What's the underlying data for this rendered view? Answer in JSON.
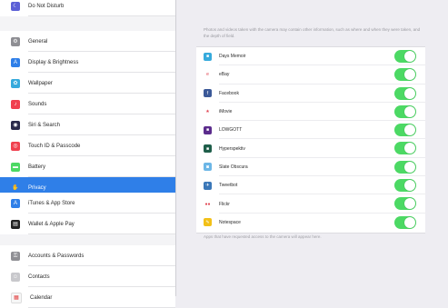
{
  "sidebar": {
    "top_item": {
      "label": "Do Not Disturb",
      "icon": "moon-icon",
      "color": "#5b5fd6"
    },
    "group1": [
      {
        "label": "General",
        "icon": "gear-icon",
        "color": "#8e8e93",
        "name": "general"
      },
      {
        "label": "Display & Brightness",
        "icon": "display-icon",
        "color": "#2f7fe8",
        "name": "display-brightness"
      },
      {
        "label": "Wallpaper",
        "icon": "wallpaper-icon",
        "color": "#36aadc",
        "name": "wallpaper"
      },
      {
        "label": "Sounds",
        "icon": "speaker-icon",
        "color": "#f0404e",
        "name": "sounds"
      },
      {
        "label": "Siri & Search",
        "icon": "siri-icon",
        "color": "#2a2a4a",
        "name": "siri-search"
      },
      {
        "label": "Touch ID & Passcode",
        "icon": "fingerprint-icon",
        "color": "#f0404e",
        "name": "touch-id-passcode"
      },
      {
        "label": "Battery",
        "icon": "battery-icon",
        "color": "#4cd964",
        "name": "battery"
      },
      {
        "label": "Privacy",
        "icon": "hand-icon",
        "color": "#2f7fe8",
        "name": "privacy",
        "selected": true
      }
    ],
    "group2": [
      {
        "label": "iTunes & App Store",
        "icon": "app-store-icon",
        "color": "#2f7fe8",
        "name": "itunes-app-store"
      },
      {
        "label": "Wallet & Apple Pay",
        "icon": "wallet-icon",
        "color": "#222222",
        "name": "wallet-apple-pay"
      }
    ],
    "group3": [
      {
        "label": "Accounts & Passwords",
        "icon": "key-icon",
        "color": "#8e8e93",
        "name": "accounts-passwords"
      },
      {
        "label": "Contacts",
        "icon": "contacts-icon",
        "color": "#c8c8cc",
        "name": "contacts"
      },
      {
        "label": "Calendar",
        "icon": "calendar-icon",
        "color": "#f7f7f7",
        "name": "calendar"
      }
    ]
  },
  "main": {
    "note_top": "Photos and videos taken with the camera may contain other information, such as where and when they were taken, and the depth of field.",
    "apps": [
      {
        "label": "Days Memoir",
        "icon": "app-icon",
        "color": "#36aadc",
        "enabled": true
      },
      {
        "label": "eBay",
        "icon": "ebay-icon",
        "color": "#ffffff",
        "enabled": true
      },
      {
        "label": "Facebook",
        "icon": "facebook-icon",
        "color": "#3b5998",
        "enabled": true
      },
      {
        "label": "iMovie",
        "icon": "star-icon",
        "color": "#ffffff",
        "enabled": true
      },
      {
        "label": "LOWGOTT",
        "icon": "app-icon",
        "color": "#5b2c8c",
        "enabled": true
      },
      {
        "label": "Hyperspektiv",
        "icon": "app-icon",
        "color": "#1f5e4a",
        "enabled": true
      },
      {
        "label": "Slate Obscura",
        "icon": "camera-icon",
        "color": "#6cb6e6",
        "enabled": true
      },
      {
        "label": "Tweetbot",
        "icon": "bird-icon",
        "color": "#3a77b8",
        "enabled": true
      },
      {
        "label": "Flickr",
        "icon": "flickr-icon",
        "color": "#ffffff",
        "enabled": true
      },
      {
        "label": "Notespace",
        "icon": "notes-icon",
        "color": "#f2c018",
        "enabled": true
      }
    ],
    "note_bottom": "Apps that have requested access to the camera will appear here.",
    "toggle_on_color": "#4cd964"
  }
}
